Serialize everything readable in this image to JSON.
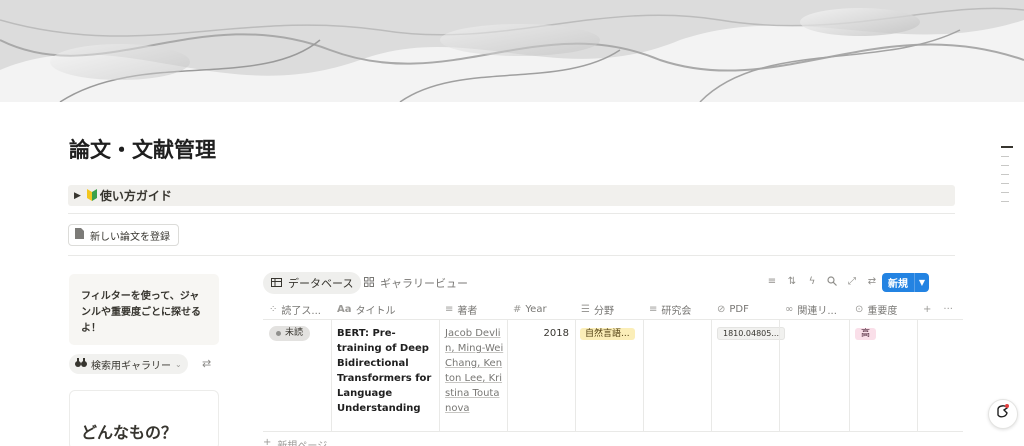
{
  "page": {
    "title": "論文・文献管理",
    "toggle_label": "使い方ガイド",
    "register_button": "新しい論文を登録"
  },
  "sidebar": {
    "callout_text": "フィルターを使って、ジャンルや重要度ごとに探せるよ！",
    "gallery_select": "検索用ギャラリー",
    "card_title": "どんなもの？"
  },
  "views": {
    "tabs": [
      {
        "label": "データベース",
        "icon": "table-icon",
        "active": true
      },
      {
        "label": "ギャラリービュー",
        "icon": "gallery-icon",
        "active": false
      }
    ],
    "new_button": "新規"
  },
  "table": {
    "columns": [
      {
        "label": "読了ス...",
        "icon": "status-icon"
      },
      {
        "label": "タイトル",
        "icon": "text-icon"
      },
      {
        "label": "著者",
        "icon": "lines-icon"
      },
      {
        "label": "Year",
        "icon": "hash-icon"
      },
      {
        "label": "分野",
        "icon": "multiselect-icon"
      },
      {
        "label": "研究会",
        "icon": "lines-icon"
      },
      {
        "label": "PDF",
        "icon": "paperclip-icon"
      },
      {
        "label": "関連リ...",
        "icon": "link-icon"
      },
      {
        "label": "重要度",
        "icon": "select-icon"
      }
    ],
    "rows": [
      {
        "status": "未読",
        "title": "BERT: Pre-training of Deep Bidirectional Transformers for Language Understanding",
        "authors": "Jacob Devlin, Ming-Wei Chang, Kenton Lee, Kristina Toutanova",
        "year": "2018",
        "field": "自然言語...",
        "pdf": "1810.04805...",
        "importance": "高"
      }
    ],
    "new_page": "新規ページ"
  },
  "colors": {
    "accent": "#2383e2",
    "tag_yellow": "#fbeeb8",
    "tag_pink": "#fadfe9"
  }
}
